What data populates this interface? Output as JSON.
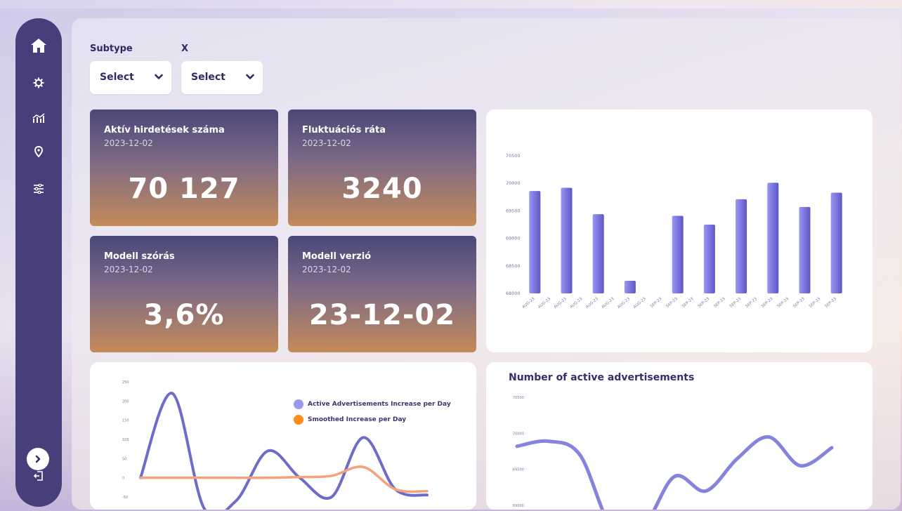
{
  "filters": [
    {
      "label": "Subtype",
      "selected": "Select"
    },
    {
      "label": "X",
      "selected": "Select"
    }
  ],
  "kpis": [
    {
      "title": "Aktív hirdetések száma",
      "date": "2023-12-02",
      "value": "70 127"
    },
    {
      "title": "Fluktuációs ráta",
      "date": "2023-12-02",
      "value": "3240"
    },
    {
      "title": "Modell szórás",
      "date": "2023-12-02",
      "value": "3,6%"
    },
    {
      "title": "Modell verzió",
      "date": "2023-12-02",
      "value": "23-12-02"
    }
  ],
  "sidebar": {
    "icons": [
      "home-icon",
      "gear-icon",
      "analytics-icon",
      "location-icon",
      "sliders-icon",
      "chevron-right-icon",
      "logout-icon"
    ]
  },
  "legend": {
    "item1": "Active Advertisements Increase per Day",
    "item2": "Smoothed Increase per Day"
  },
  "colors": {
    "sidebar": "#463f7a",
    "bar": "#7f7ae6",
    "line_primary": "#6f6bc9",
    "line_smoothed": "#ff9a5a",
    "legend_dot_1": "#9a97f0",
    "legend_dot_2": "#ff8c1a"
  },
  "chart_data": [
    {
      "type": "bar",
      "title": "",
      "categories": [
        "AUG-23",
        "AUG-23",
        "AUG-23",
        "AUG-23",
        "AUG-23",
        "AUG-23",
        "AUG-23",
        "AUG-23",
        "SEP-23",
        "SEP-23",
        "SEP-23",
        "SEP-23",
        "SEP-23",
        "SEP-23",
        "SEP-23",
        "SEP-23",
        "SEP-23",
        "SEP-23",
        "SEP-23",
        "SEP-23"
      ],
      "values": [
        69860,
        69920,
        69440,
        68230,
        69410,
        69250,
        69710,
        70010,
        69570,
        69830
      ],
      "yticks": [
        68000,
        68500,
        69000,
        69500,
        70000,
        70500
      ],
      "ylim": [
        68000,
        70500
      ]
    },
    {
      "type": "line",
      "title": "",
      "yticks": [
        -50,
        0,
        50,
        100,
        150,
        200,
        250
      ],
      "ylim": [
        -50,
        250
      ],
      "series": [
        {
          "name": "Active Advertisements Increase per Day",
          "values": [
            0,
            220,
            -80,
            -60,
            70,
            0,
            -50,
            105,
            -30,
            -45
          ]
        },
        {
          "name": "Smoothed Increase per Day",
          "values": [
            0,
            0,
            0,
            0,
            0,
            2,
            5,
            28,
            -30,
            -35
          ]
        }
      ]
    },
    {
      "type": "line",
      "title": "Number of active advertisements",
      "yticks": [
        69000,
        69500,
        70000,
        70500
      ],
      "ylim": [
        69000,
        70500
      ],
      "series": [
        {
          "values": [
            69820,
            69890,
            69700,
            68700,
            68700,
            69400,
            69200,
            69650,
            69950,
            69550,
            69800
          ]
        }
      ]
    }
  ]
}
